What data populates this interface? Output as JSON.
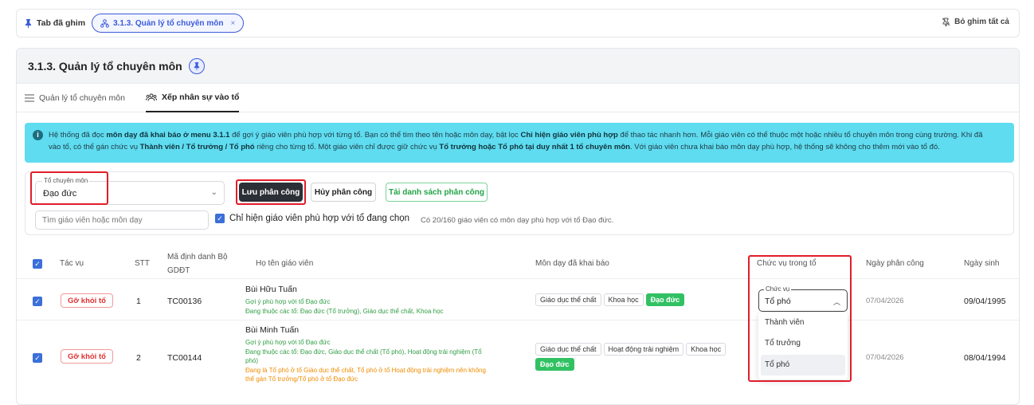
{
  "pinbar": {
    "label": "Tab đã ghim",
    "chip_label": "3.1.3. Quản lý tổ chuyên môn",
    "chip_close": "×",
    "unpin_all": "Bỏ ghim tất cả"
  },
  "page": {
    "title": "3.1.3. Quản lý tổ chuyên môn"
  },
  "tabs": [
    {
      "label": "Quản lý tổ chuyên môn"
    },
    {
      "label": "Xếp nhân sự vào tổ"
    }
  ],
  "alert": {
    "p1": "Hệ thống đã đọc ",
    "b1": "môn dạy đã khai báo ở menu 3.1.1",
    "p2": " để gợi ý giáo viên phù hợp với từng tổ. Bạn có thể tìm theo tên hoặc môn dạy, bật lọc ",
    "b2": "Chỉ hiện giáo viên phù hợp",
    "p3": " để thao tác nhanh hơn. Mỗi giáo viên có thể thuộc một hoặc nhiều tổ chuyên môn trong cùng trường. Khi đã",
    "p4": "vào tổ, có thể gán chức vụ ",
    "b3": "Thành viên / Tổ trưởng / Tổ phó",
    "p5": " riêng cho từng tổ. Một giáo viên chỉ được giữ chức vụ ",
    "b4": "Tổ trưởng hoặc Tổ phó tại duy nhất 1 tổ chuyên môn",
    "p6": ". Với giáo viên chưa khai báo môn dạy phù hợp, hệ thống sẽ không cho thêm mới vào tổ đó."
  },
  "filter": {
    "select_legend": "Tổ chuyên môn",
    "select_value": "Đạo đức",
    "save_btn": "Lưu phân công",
    "cancel_btn": "Hủy phân công",
    "reload_btn": "Tải danh sách phân công",
    "search_placeholder": "Tìm giáo viên hoặc môn dạy",
    "only_match_label": "Chỉ hiện giáo viên phù hợp với tổ đang chọn",
    "count_note": "Có 20/160 giáo viên có môn dạy phù hợp với tổ Đạo đức."
  },
  "table": {
    "headers": {
      "action": "Tác vụ",
      "stt": "STT",
      "code_1": "Mã định danh Bộ",
      "code_2": "GDĐT",
      "name": "Họ tên giáo viên",
      "subjects": "Môn dạy đã khai báo",
      "role": "Chức vụ trong tổ",
      "assign_date": "Ngày phân công",
      "dob": "Ngày sinh"
    },
    "rows": [
      {
        "action": "Gỡ khỏi tổ",
        "stt": "1",
        "code": "TC00136",
        "name": "Bùi Hữu Tuấn",
        "hint": "Gợi ý phù hợp với tổ Đạo đức",
        "groups": "Đang thuộc các tổ: Đạo đức (Tổ trưởng), Giáo dục thể chất, Khoa học",
        "subjects": [
          "Giáo dục thể chất",
          "Khoa học",
          "Đạo đức"
        ],
        "assign_date": "07/04/2026",
        "dob": "09/04/1995"
      },
      {
        "action": "Gỡ khỏi tổ",
        "stt": "2",
        "code": "TC00144",
        "name": "Bùi Minh Tuấn",
        "hint": "Gợi ý phù hợp với tổ Đạo đức",
        "groups_1": "Đang thuộc các tổ: Đạo đức, Giáo dục thể chất (Tổ phó), Hoạt động trải nghiệm (Tổ",
        "groups_2": "phó)",
        "warn_1": "Đang là Tổ phó ở tổ Giáo dục thể chất, Tổ phó ở tổ Hoạt động trải nghiệm nên không",
        "warn_2": "thể gán Tổ trưởng/Tổ phó ở tổ Đạo đức",
        "subjects": [
          "Giáo dục thể chất",
          "Hoạt động trải nghiệm",
          "Khoa học",
          "Đạo đức"
        ],
        "assign_date": "07/04/2026",
        "dob": "08/04/1994"
      }
    ]
  },
  "role_dropdown": {
    "legend": "Chức vụ",
    "value": "Tổ phó",
    "options": [
      "Thành viên",
      "Tổ trưởng",
      "Tổ phó"
    ]
  }
}
